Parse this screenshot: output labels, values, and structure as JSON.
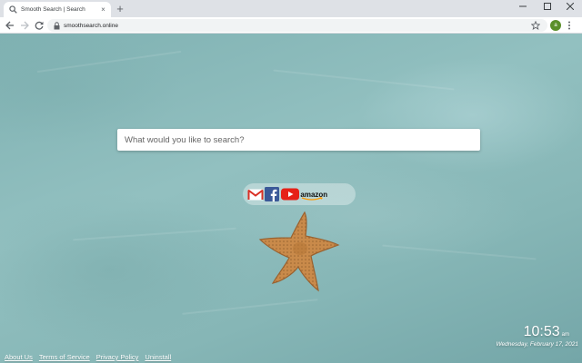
{
  "browser": {
    "tab": {
      "title": "Smooth Search | Search",
      "icon": "search-icon"
    },
    "new_tab_label": "+",
    "address": "smoothsearch.online",
    "profile_initial": "a"
  },
  "search": {
    "placeholder": "What would you like to search?",
    "value": ""
  },
  "shortcuts": [
    {
      "name": "Gmail",
      "icon": "gmail-icon"
    },
    {
      "name": "Facebook",
      "icon": "facebook-icon"
    },
    {
      "name": "YouTube",
      "icon": "youtube-icon"
    },
    {
      "name": "Amazon",
      "label": "amazon",
      "icon": "amazon-icon"
    }
  ],
  "clock": {
    "time": "10:53",
    "ampm": "am",
    "date": "Wednesday, February 17, 2021"
  },
  "footer": {
    "links": [
      "About Us",
      "Terms of Service",
      "Privacy Policy",
      "Uninstall"
    ]
  },
  "colors": {
    "page_background": "#88b8b8",
    "starfish": "#c98a4a",
    "facebook": "#3b5998",
    "youtube": "#e62117",
    "gmail": "#d93025"
  }
}
